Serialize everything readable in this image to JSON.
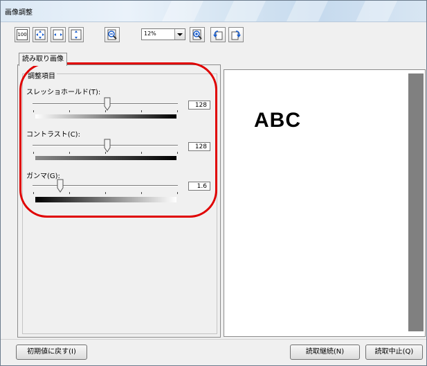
{
  "window": {
    "title": "画像調整"
  },
  "toolbar": {
    "buttons": [
      {
        "name": "actual-size-100-icon",
        "label": "100"
      },
      {
        "name": "fit-page-icon"
      },
      {
        "name": "fit-width-icon"
      },
      {
        "name": "fit-height-icon"
      },
      {
        "name": "zoom-out-icon"
      },
      {
        "name": "zoom-in-icon"
      },
      {
        "name": "rotate-left-icon"
      },
      {
        "name": "rotate-right-icon"
      }
    ],
    "zoom_value": "12%"
  },
  "tabs": [
    {
      "label": "読み取り画像",
      "active": true
    }
  ],
  "adjust": {
    "group_label": "調整項目",
    "threshold": {
      "label": "スレッショホールド(T):",
      "value": "128"
    },
    "contrast": {
      "label": "コントラスト(C):",
      "value": "128"
    },
    "gamma": {
      "label": "ガンマ(G):",
      "value": "1.6"
    }
  },
  "preview": {
    "text": "ABC"
  },
  "buttons": {
    "reset": "初期値に戻す(I)",
    "continue": "読取継続(N)",
    "stop": "読取中止(Q)"
  },
  "colors": {
    "highlight": "#e00000",
    "preview_bar": "#808080"
  }
}
